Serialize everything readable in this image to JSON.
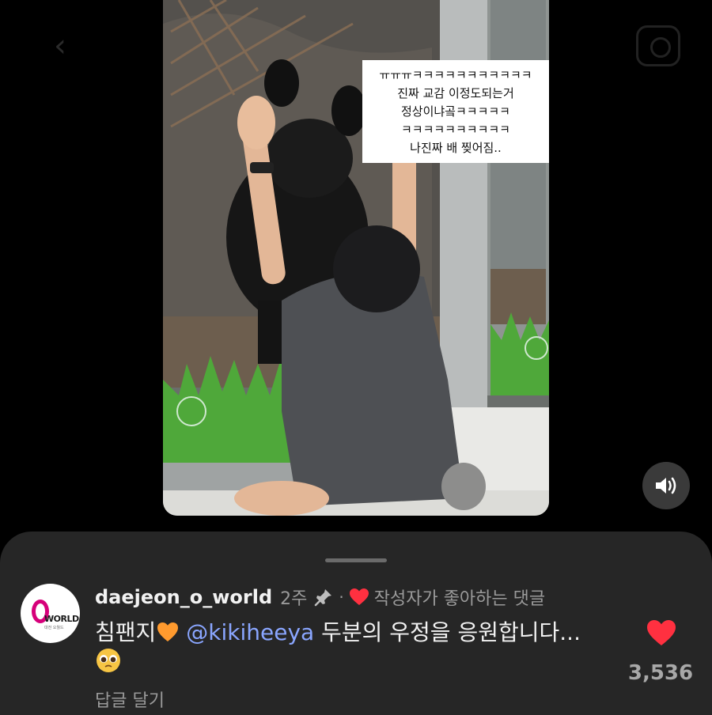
{
  "video": {
    "caption_lines": [
      "ㅠㅠㅠㅋㅋㅋㅋㅋㅋㅋㅋㅋㅋㅋ",
      "진짜 교감 이정도되는거",
      "정상이냐곸ㅋㅋㅋㅋㅋ",
      "ㅋㅋㅋㅋㅋㅋㅋㅋㅋㅋ",
      "나진짜 배 찢어짐.."
    ],
    "volume_icon": "speaker-on-icon"
  },
  "comment": {
    "avatar": {
      "brand": "WORLD",
      "tagline": "대전 오월드"
    },
    "username": "daejeon_o_world",
    "time": "2주",
    "separator": "·",
    "creator_like_label": "작성자가 좋아하는 댓글",
    "text_before": "침팬지",
    "mention": "@kikiheeya",
    "text_after": " 두분의 우정을 응원합니다...",
    "reply_label": "답글 달기",
    "like_count": "3,536",
    "liked": true,
    "accent_colors": {
      "heart": "#ff3040",
      "mention": "#8aa6ff",
      "orange_heart": "#ff9a2e"
    }
  }
}
